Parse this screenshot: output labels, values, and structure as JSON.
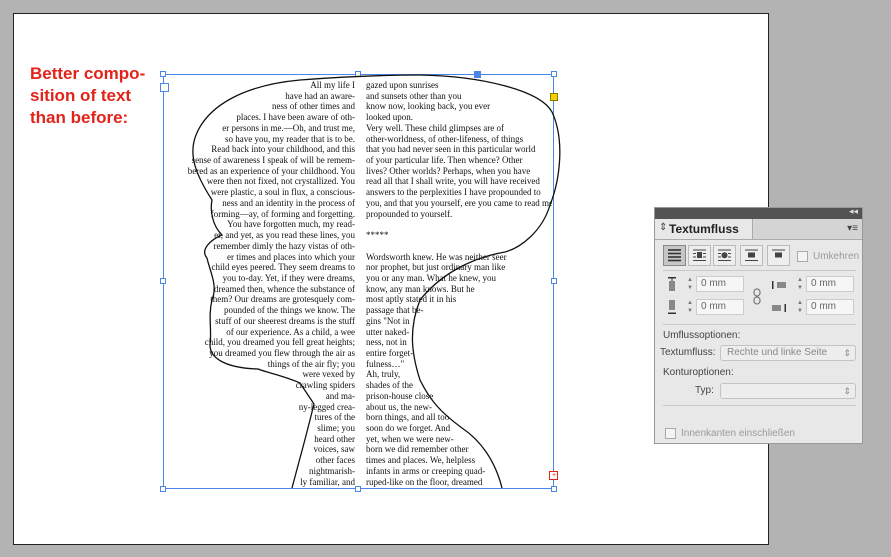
{
  "caption": [
    "Better compo-",
    "sition of text",
    "than before:"
  ],
  "text_left": [
    "All my life I",
    "have had an aware-",
    "ness of other times and",
    "places. I have been aware of oth-",
    "er persons in me.—Oh, and trust me,",
    "so have you, my reader that is to be.",
    "Read back into your childhood, and this",
    "sense of awareness I speak of will be remem-",
    "bered as an experience of your childhood. You",
    "were then not fixed, not crystallized. You",
    "were plastic, a soul in flux, a conscious-",
    "ness and an identity in the process of",
    "forming—ay, of forming and forgetting.",
    "You have forgotten much, my read-",
    "er, and yet, as you read these lines, you",
    "remember dimly the hazy vistas of oth-",
    "er times and places into which your",
    "child eyes peered. They seem dreams to",
    "you to-day. Yet, if they were dreams,",
    "dreamed then, whence the substance of",
    "them? Our dreams are grotesquely com-",
    "pounded of the things we know. The",
    "stuff of our sheerest dreams is the stuff",
    "of our experience. As a child, a wee",
    "child, you dreamed you fell great heights;",
    "you dreamed you flew through the air as",
    "things of the air fly; you",
    "were vexed by",
    "crawling spiders",
    "and ma-",
    "ny-legged crea-",
    "tures of the",
    "slime; you",
    "heard other",
    "voices, saw",
    "other faces",
    "nightmarish-",
    "ly familiar, and"
  ],
  "text_right": [
    "gazed upon sunrises",
    "and sunsets other than you",
    "know now, looking back, you ever",
    "looked upon.",
    "Very well. These child glimpses are of",
    "other-worldness, of other-lifeness, of things",
    "that you had never seen in this particular world",
    "of your particular life. Then whence? Other",
    "lives? Other worlds? Perhaps, when you have",
    "read all that I shall write, you will have received",
    "answers to the perplexities I have propounded to",
    "you, and that you yourself, ere you came to read me,",
    "propounded to yourself.",
    "",
    "*****",
    "",
    "Wordsworth knew. He was neither seer",
    "nor prophet, but just ordinary man like",
    "you or any man. What he knew, you",
    "know, any man knows. But he",
    "most aptly stated it in his",
    "passage that be-",
    "gins \"Not in",
    "utter naked-",
    "ness, not in",
    "entire forget-",
    "fulness…\"",
    "Ah, truly,",
    "shades of the",
    "prison-house close",
    "about us, the new-",
    "born things, and all too",
    "soon do we forget. And",
    "yet, when we were new-",
    "born we did remember other",
    "times and places. We, helpless",
    "infants in arms or creeping quad-",
    "ruped-like on the floor, dreamed"
  ],
  "panel": {
    "title": "Textumfluss",
    "wrap_buttons": [
      "no-wrap-icon",
      "wrap-bounding-box-icon",
      "wrap-object-shape-icon",
      "jump-object-icon",
      "jump-to-next-column-icon"
    ],
    "invert_label": "Umkehren",
    "offsets": {
      "top": "0 mm",
      "bottom": "0 mm",
      "left": "0 mm",
      "right": "0 mm"
    },
    "wrap_options_heading": "Umflussoptionen:",
    "wrap_to_label": "Textumfluss:",
    "wrap_to_value": "Rechte und linke Seite",
    "contour_heading": "Konturoptionen:",
    "type_label": "Typ:",
    "type_value": "",
    "inside_edges_label": "Innenkanten einschließen"
  }
}
